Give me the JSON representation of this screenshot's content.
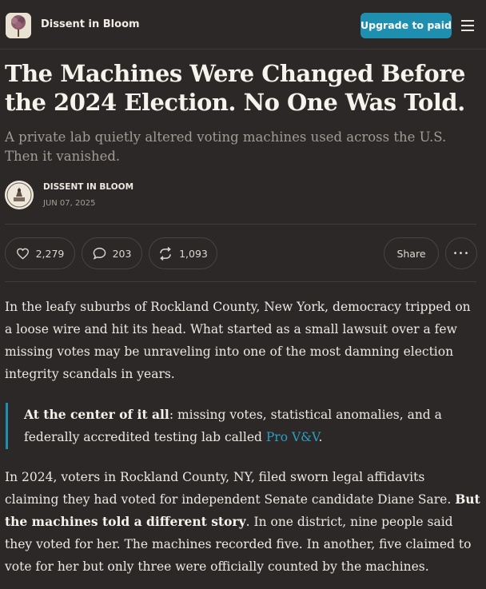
{
  "publication": {
    "name": "Dissent in Bloom"
  },
  "header": {
    "upgrade_label": "Upgrade to paid",
    "menu_icon": "hamburger-menu-icon"
  },
  "post": {
    "title": "The Machines Were Changed Before the 2024 Election. No One Was Told.",
    "subtitle": "A private lab quietly altered voting machines used across the U.S. Then it vanished.",
    "author": "DISSENT IN BLOOM",
    "date": "JUN 07, 2025"
  },
  "actions": {
    "likes": "2,279",
    "comments": "203",
    "restacks": "1,093",
    "share_label": "Share",
    "more_label": "•••"
  },
  "article": {
    "p1": "In the leafy suburbs of Rockland County, New York, democracy tripped on a loose wire and hit its head. What started as a small lawsuit over a few missing votes may be unraveling into one of the most damning election integrity scandals in years.",
    "quote_bold": "At the center of it all",
    "quote_text": ": missing votes, statistical anomalies, and a federally accredited testing lab called ",
    "quote_link": "Pro V&V",
    "quote_end": ".",
    "p2_a": "In 2024, voters in Rockland County, NY, filed sworn legal affidavits claiming they had voted for independent Senate candidate Diane Sare. ",
    "p2_bold": "But the machines told a different story",
    "p2_b": ". In one district, nine people said they voted for her. The machines recorded five. In another, five claimed to vote for her but only three were officially counted by the machines."
  },
  "colors": {
    "accent": "#1f8fb0",
    "background": "#2b2827",
    "link": "#2b9fc2"
  }
}
